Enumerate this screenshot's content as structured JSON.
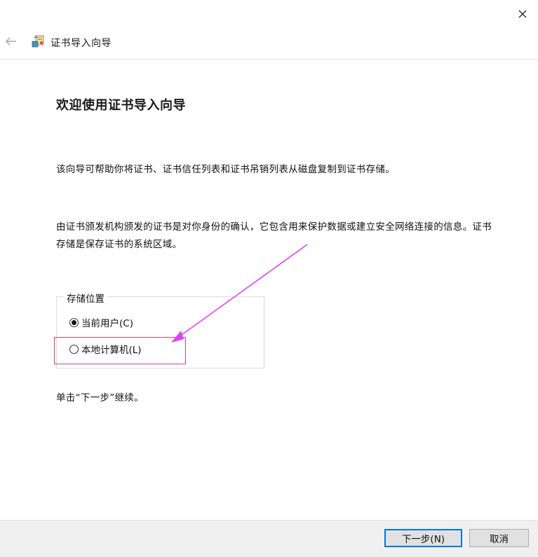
{
  "header": {
    "title": "证书导入向导",
    "back_icon": "arrow-left-icon",
    "wizard_icon": "certificate-wizard-icon",
    "close_icon": "close-icon"
  },
  "main": {
    "title": "欢迎使用证书导入向导",
    "paragraph1": "该向导可帮助你将证书、证书信任列表和证书吊销列表从磁盘复制到证书存储。",
    "paragraph2": "由证书颁发机构颁发的证书是对你身份的确认，它包含用来保护数据或建立安全网络连接的信息。证书存储是保存证书的系统区域。",
    "store_location": {
      "legend": "存储位置",
      "options": [
        {
          "label": "当前用户(C)",
          "selected": true
        },
        {
          "label": "本地计算机(L)",
          "selected": false
        }
      ]
    },
    "instruction": "单击“下一步”继续。"
  },
  "footer": {
    "next_label": "下一步(N)",
    "cancel_label": "取消"
  },
  "colors": {
    "accent": "#0078d7",
    "annotation_arrow": "#e040fb",
    "annotation_box": "#d9436a"
  }
}
